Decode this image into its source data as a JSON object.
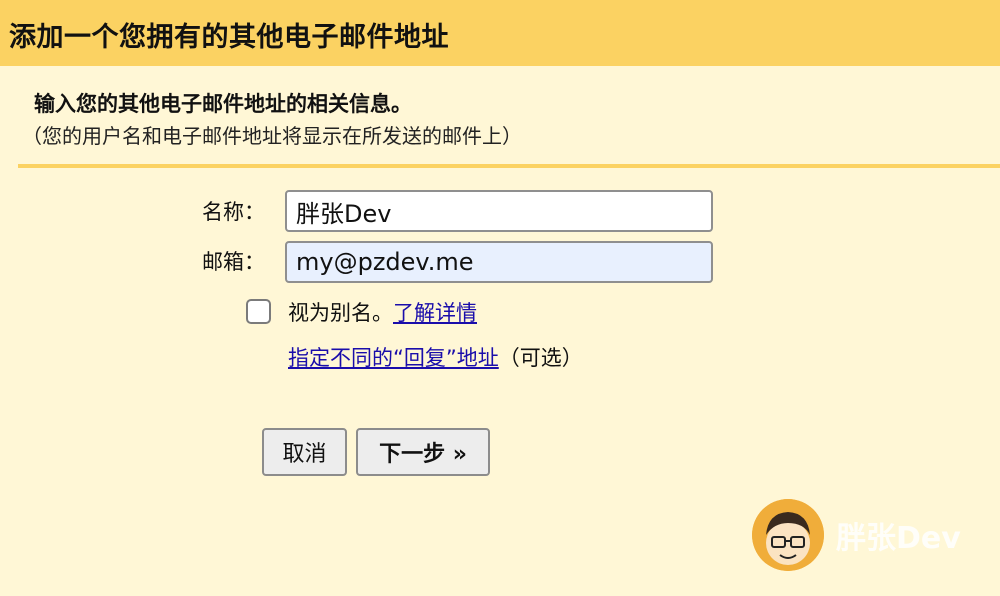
{
  "header": {
    "title": "添加一个您拥有的其他电子邮件地址"
  },
  "intro": {
    "lead": "输入您的其他电子邮件地址的相关信息。",
    "note": "（您的用户名和电子邮件地址将显示在所发送的邮件上）"
  },
  "form": {
    "name_label": "名称：",
    "name_value": "胖张Dev",
    "email_label": "邮箱：",
    "email_value": "my@pzdev.me",
    "alias_label": "视为别名。",
    "alias_checked": false,
    "learn_more_link": "了解详情",
    "reply_to_link": "指定不同的“回复”地址",
    "reply_to_optional": "（可选）"
  },
  "buttons": {
    "cancel": "取消",
    "next": "下一步 »"
  },
  "watermark": {
    "text": "胖张Dev"
  },
  "colors": {
    "header_bg": "#fbd262",
    "page_bg": "#fff7d6",
    "link": "#1a0dab",
    "autofill_bg": "#e8f0fe"
  }
}
